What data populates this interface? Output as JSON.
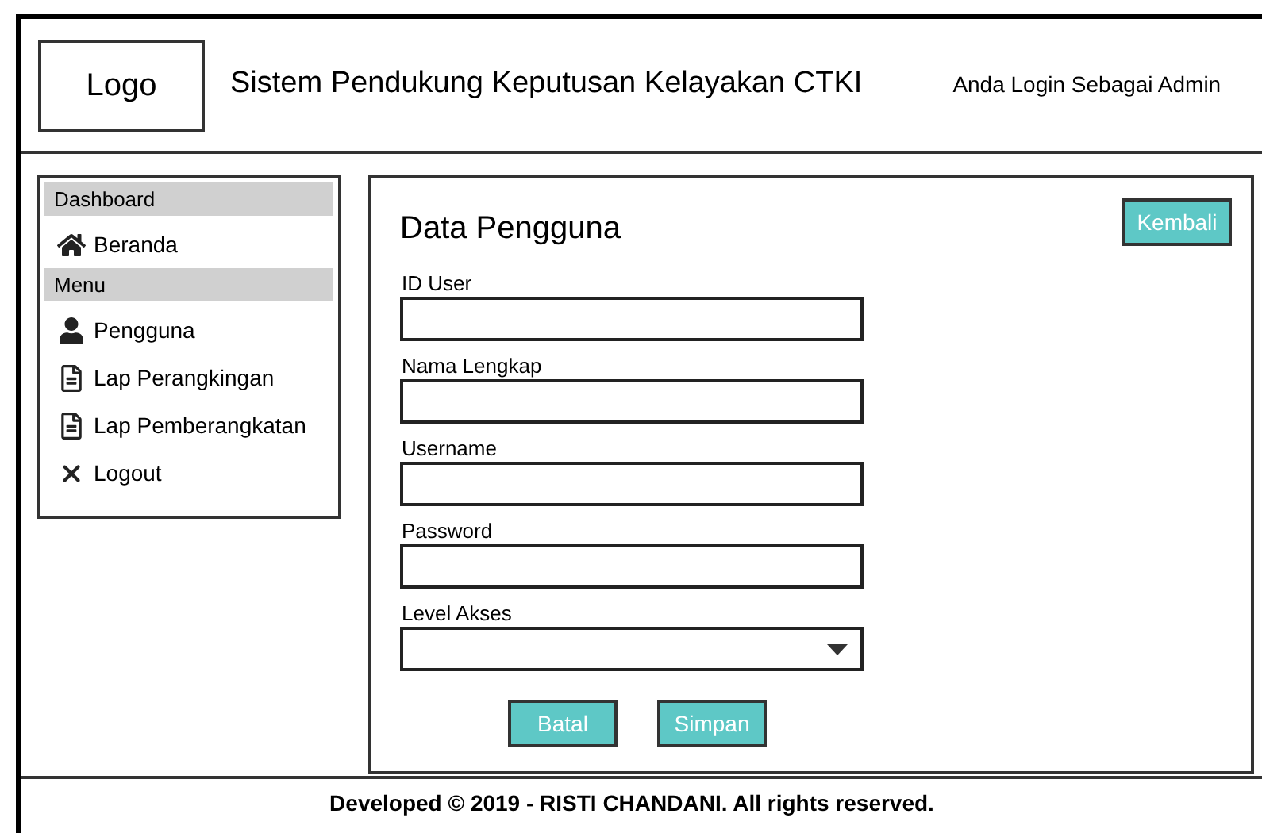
{
  "header": {
    "logo": "Logo",
    "title": "Sistem Pendukung Keputusan Kelayakan CTKI",
    "login_text": "Anda Login Sebagai Admin"
  },
  "sidebar": {
    "items": [
      {
        "kind": "header",
        "label": "Dashboard"
      },
      {
        "kind": "link",
        "label": "Beranda"
      },
      {
        "kind": "header",
        "label": "Menu"
      },
      {
        "kind": "link",
        "label": "Pengguna"
      },
      {
        "kind": "link",
        "label": "Lap Perangkingan"
      },
      {
        "kind": "link",
        "label": "Lap Pemberangkatan"
      },
      {
        "kind": "link",
        "label": "Logout"
      }
    ]
  },
  "panel": {
    "title": "Data Pengguna",
    "back_button": "Kembali",
    "fields": [
      {
        "kind": "text",
        "label": "ID User"
      },
      {
        "kind": "text",
        "label": "Nama Lengkap"
      },
      {
        "kind": "text",
        "label": "Username"
      },
      {
        "kind": "text",
        "label": "Password"
      },
      {
        "kind": "select",
        "label": "Level Akses"
      }
    ],
    "buttons": [
      "Batal",
      "Simpan"
    ]
  },
  "footer": "Developed © 2019 - RISTI CHANDANI. All rights reserved."
}
